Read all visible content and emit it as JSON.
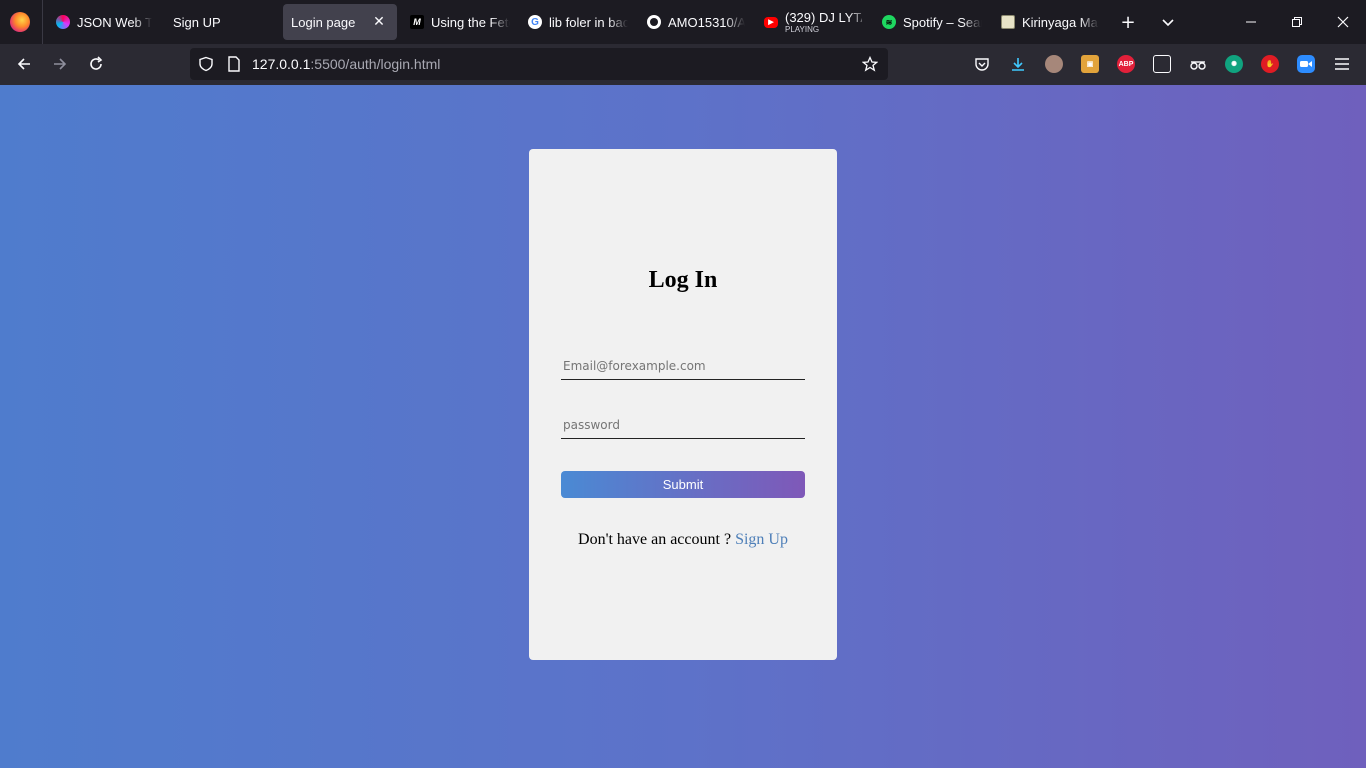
{
  "browser": {
    "tabs": [
      {
        "title": "JSON Web Tok",
        "favicon": "jwt-icon",
        "active": false
      },
      {
        "title": "Sign UP",
        "favicon": "",
        "active": false
      },
      {
        "title": "Login page",
        "favicon": "",
        "active": true
      },
      {
        "title": "Using the Fetc",
        "favicon": "mdn-icon",
        "active": false
      },
      {
        "title": "lib foler in bac",
        "favicon": "google-icon",
        "active": false
      },
      {
        "title": "AMO15310/AU",
        "favicon": "github-icon",
        "active": false
      },
      {
        "title": "(329) DJ LYTA",
        "subtitle": "PLAYING",
        "favicon": "youtube-icon",
        "active": false
      },
      {
        "title": "Spotify – Searc",
        "favicon": "spotify-icon",
        "active": false
      },
      {
        "title": "Kirinyaga Mas",
        "favicon": "site-icon",
        "active": false
      }
    ],
    "url_host": "127.0.0.1",
    "url_rest": ":5500/auth/login.html",
    "extensions": [
      "pocket-icon",
      "download-icon",
      "avatar-icon",
      "image-ext-icon",
      "adblock-plus-icon",
      "reader-icon",
      "spy-icon",
      "chatgpt-icon",
      "stop-hand-icon",
      "zoom-icon"
    ],
    "adblock_label": "ABP"
  },
  "login": {
    "title": "Log In",
    "email_placeholder": "Email@forexample.com",
    "password_placeholder": "password",
    "submit_label": "Submit",
    "signup_prompt": "Don't have an account ?",
    "signup_link": "Sign Up"
  },
  "colors": {
    "bg_left": "#4f7ccd",
    "bg_right": "#6f60bd",
    "card": "#f1f1f1",
    "button_left": "#4a8ad4",
    "button_right": "#7f58b8",
    "link": "#4e7fb8"
  }
}
